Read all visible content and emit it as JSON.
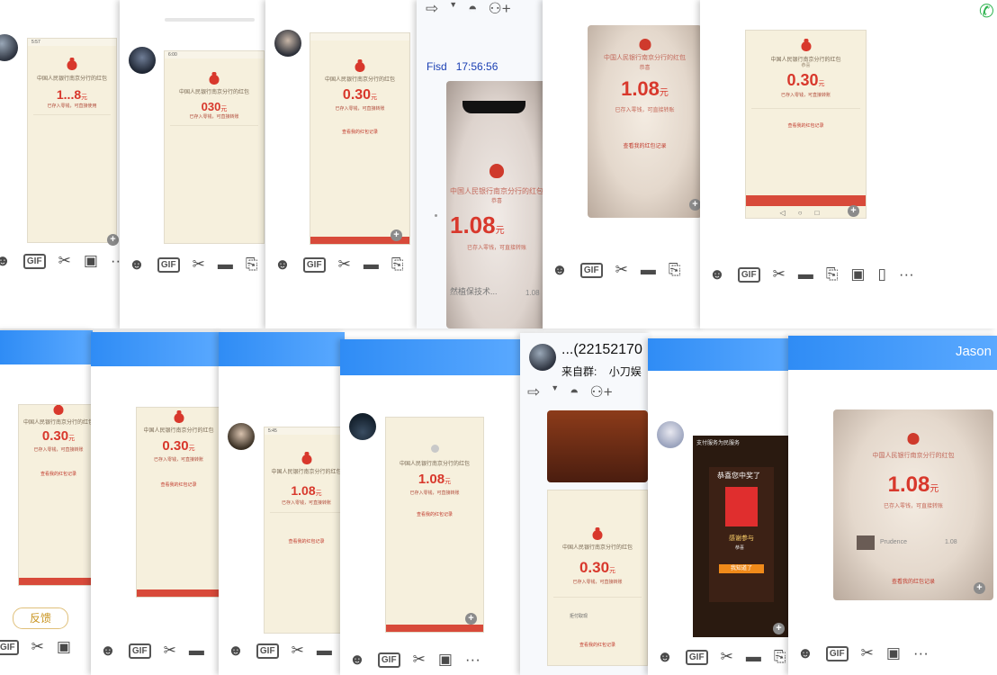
{
  "bank_text": "中国人民银行南京分行的红包",
  "greeting": "恭喜",
  "deposited_note": "已存入零钱，可直接转账",
  "deposited_note_short": "已存入零钱，可直接使用",
  "records_link": "查看我的红包记录",
  "yuan": "元",
  "sender_name": "Fisd",
  "sender_time": "17:56:56",
  "snippet": "然植保技术...",
  "snippet_amount": "1.08",
  "contact_id": "...(22152170",
  "from_group_label": "来自群:",
  "group_name": "小刀娱",
  "window_title": "Jason",
  "feedback_label": "反馈",
  "prize_title": "恭喜您中奖了",
  "prize_thanks": "感谢参与",
  "prize_button": "我知道了",
  "prize_header": "支付服务为民服务",
  "prudence_label": "Prudence",
  "prudence_amount": "1.08",
  "pending_icon_item": "拒付取现",
  "amounts": {
    "a1": "1...8",
    "a2": "030",
    "a3": "0.30",
    "a5": "1.08",
    "a6": "0.30",
    "b1": "0.30",
    "b2": "0.30",
    "b3": "1.08",
    "b4": "1.08",
    "b5": "0.30",
    "b7": "1.08"
  },
  "toolbar": {
    "gif_label": "GIF",
    "icons": [
      "emoji-icon",
      "gif-icon",
      "scissors-icon",
      "folder-icon",
      "image-icon",
      "more-icon"
    ]
  },
  "status_bar": {
    "t1": "5:57",
    "t2": "6:00",
    "t3": "5:45"
  },
  "colors": {
    "header_blue": "#3b8ff7",
    "packet_red": "#d8382c",
    "paper": "#f6f0dd"
  }
}
